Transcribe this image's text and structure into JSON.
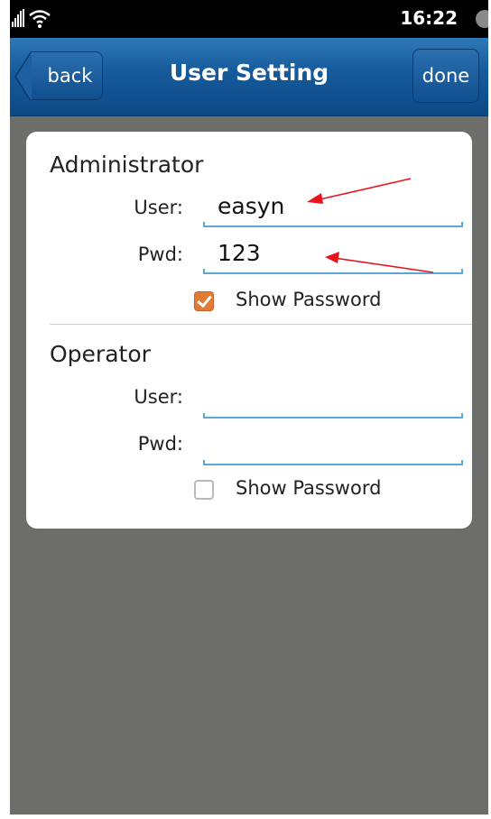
{
  "status_bar": {
    "time": "16:22",
    "icons": [
      "signal-icon",
      "wifi-icon",
      "battery-icon"
    ]
  },
  "nav": {
    "back_label": "back",
    "title": "User Setting",
    "done_label": "done"
  },
  "administrator": {
    "title": "Administrator",
    "user_label": "User:",
    "user_value": "easyn",
    "pwd_label": "Pwd:",
    "pwd_value": "123",
    "show_password_label": "Show Password",
    "show_password_checked": true
  },
  "operator": {
    "title": "Operator",
    "user_label": "User:",
    "user_value": "",
    "pwd_label": "Pwd:",
    "pwd_value": "",
    "show_password_label": "Show Password",
    "show_password_checked": false
  },
  "colors": {
    "nav_blue": "#155a9a",
    "background": "#6d6e6a",
    "accent_orange": "#e07a35",
    "field_underline": "#5aa7d8",
    "annotation_arrow": "#e8141c"
  }
}
